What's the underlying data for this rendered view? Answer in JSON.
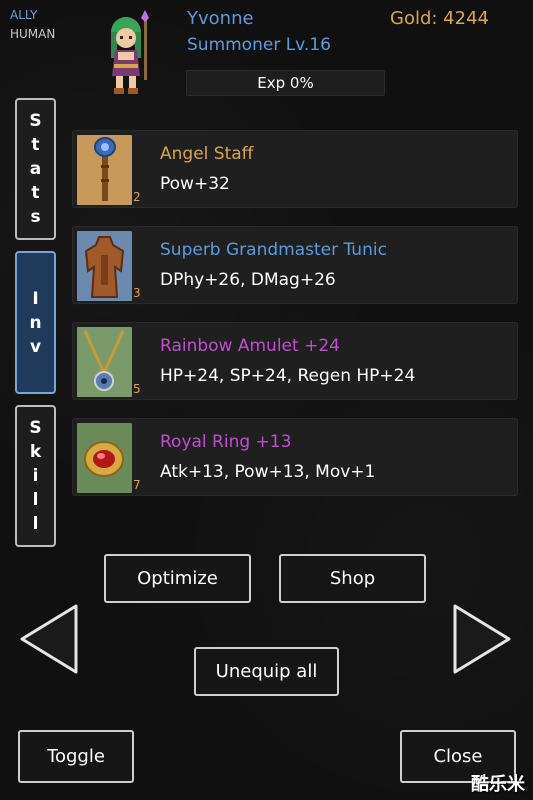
{
  "header": {
    "faction": "ALLY",
    "race": "HUMAN",
    "name": "Yvonne",
    "class_level": "Summoner Lv.16",
    "gold": "Gold: 4244",
    "exp_text": "Exp 0%",
    "exp_fraction": 0
  },
  "tabs": [
    {
      "letters": [
        "S",
        "t",
        "a",
        "t",
        "s"
      ],
      "icon": "stats-tab"
    },
    {
      "letters": [
        "I",
        "n",
        "v"
      ],
      "icon": "inventory-tab",
      "active": true
    },
    {
      "letters": [
        "S",
        "k",
        "i",
        "l",
        "l"
      ],
      "icon": "skill-tab"
    }
  ],
  "items": [
    {
      "name": "Angel Staff",
      "stats": "Pow+32",
      "slot": "2",
      "color": "#d9a840",
      "icon": "staff-icon"
    },
    {
      "name": "Superb Grandmaster Tunic",
      "stats": "DPhy+26, DMag+26",
      "slot": "3",
      "color": "#5b9be0",
      "icon": "tunic-icon"
    },
    {
      "name": "Rainbow Amulet +24",
      "stats": "HP+24, SP+24, Regen HP+24",
      "slot": "5",
      "color": "#c04fd0",
      "icon": "amulet-icon"
    },
    {
      "name": "Royal Ring +13",
      "stats": "Atk+13, Pow+13, Mov+1",
      "slot": "7",
      "color": "#c04fd0",
      "icon": "ring-icon"
    }
  ],
  "buttons": {
    "optimize": "Optimize",
    "shop": "Shop",
    "unequip_all": "Unequip all",
    "toggle": "Toggle",
    "close": "Close"
  },
  "watermark": "酷乐米"
}
